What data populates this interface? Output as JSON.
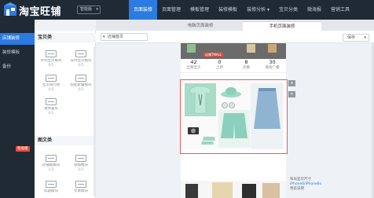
{
  "app": {
    "logo_text": "淘宝旺铺",
    "badge": "智能版"
  },
  "nav": [
    {
      "label": "页面装修",
      "active": true
    },
    {
      "label": "页面管理",
      "active": false
    },
    {
      "label": "模板管理",
      "active": false
    },
    {
      "label": "装修模板",
      "active": false
    },
    {
      "label": "装修分析 ▾",
      "active": false
    },
    {
      "label": "宝贝分类",
      "active": false
    },
    {
      "label": "微海报",
      "active": false
    },
    {
      "label": "营销工具",
      "active": false
    }
  ],
  "subtabs": {
    "pc": "电脑页面装修",
    "mobile": "手机页面装修"
  },
  "leftnav": [
    {
      "label": "店铺装修",
      "active": true
    },
    {
      "label": "装修模板",
      "active": false
    },
    {
      "label": "备份",
      "active": false
    }
  ],
  "panel": {
    "section1": "宝贝类",
    "section2": "图文类",
    "hot_badge": "智能版",
    "baobei_modules": [
      {
        "name": "单列宝贝模块",
        "count": "0/5"
      },
      {
        "name": "双列宝贝模块",
        "count": "0/5"
      },
      {
        "name": "宝贝排行榜",
        "count": "0/5"
      },
      {
        "name": "搭配套餐模块",
        "count": "0/5"
      },
      {
        "name": "猜你喜欢",
        "count": "0/1"
      }
    ],
    "tuwen_modules": [
      {
        "name": "轮播图模块",
        "count": "1/3"
      },
      {
        "name": "视频模块",
        "count": "0/1"
      },
      {
        "name": "标题模块",
        "count": ""
      },
      {
        "name": "文本模块",
        "count": ""
      }
    ]
  },
  "toolbar": {
    "store_select": "店铺首页",
    "save_label": "保存"
  },
  "phone": {
    "tag": "店铺TMALL",
    "stats": [
      {
        "num": "42",
        "label": "全部宝贝"
      },
      {
        "num": "0",
        "label": "上新"
      },
      {
        "num": "8",
        "label": "优惠"
      },
      {
        "num": "30",
        "label": "微淘广播"
      }
    ],
    "side_controls": [
      "▾",
      "✕"
    ]
  },
  "mobile_info": {
    "line1": "iPhone6/iPhone6s",
    "line2": "预览说明",
    "prefix": "布局显示尺寸"
  }
}
